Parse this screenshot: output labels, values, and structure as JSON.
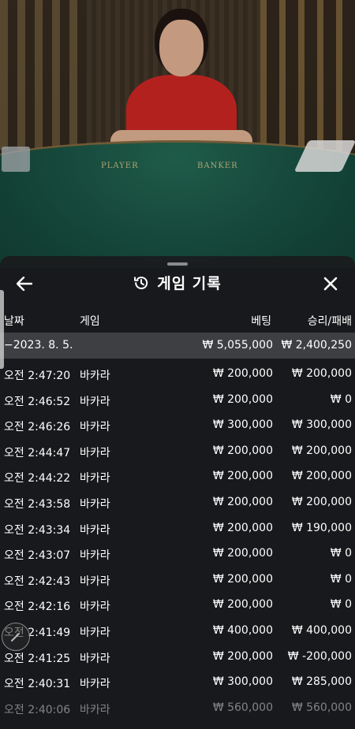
{
  "header": {
    "title": "게임 기록"
  },
  "columns": {
    "date": "날짜",
    "game": "게임",
    "bet": "베팅",
    "result": "승리/패배"
  },
  "summary": {
    "date": "−2023. 8. 5.",
    "bet": "₩ 5,055,000",
    "result": "₩ 2,400,250"
  },
  "rows": [
    {
      "time": "오전 2:47:20",
      "game": "바카라",
      "bet": "₩ 200,000",
      "result": "₩ 200,000"
    },
    {
      "time": "오전 2:46:52",
      "game": "바카라",
      "bet": "₩ 200,000",
      "result": "₩ 0"
    },
    {
      "time": "오전 2:46:26",
      "game": "바카라",
      "bet": "₩ 300,000",
      "result": "₩ 300,000"
    },
    {
      "time": "오전 2:44:47",
      "game": "바카라",
      "bet": "₩ 200,000",
      "result": "₩ 200,000"
    },
    {
      "time": "오전 2:44:22",
      "game": "바카라",
      "bet": "₩ 200,000",
      "result": "₩ 200,000"
    },
    {
      "time": "오전 2:43:58",
      "game": "바카라",
      "bet": "₩ 200,000",
      "result": "₩ 200,000"
    },
    {
      "time": "오전 2:43:34",
      "game": "바카라",
      "bet": "₩ 200,000",
      "result": "₩ 190,000"
    },
    {
      "time": "오전 2:43:07",
      "game": "바카라",
      "bet": "₩ 200,000",
      "result": "₩ 0"
    },
    {
      "time": "오전 2:42:43",
      "game": "바카라",
      "bet": "₩ 200,000",
      "result": "₩ 0"
    },
    {
      "time": "오전 2:42:16",
      "game": "바카라",
      "bet": "₩ 200,000",
      "result": "₩ 0"
    },
    {
      "time": "오전 2:41:49",
      "game": "바카라",
      "bet": "₩ 400,000",
      "result": "₩ 400,000"
    },
    {
      "time": "오전 2:41:25",
      "game": "바카라",
      "bet": "₩ 200,000",
      "result": "₩ -200,000"
    },
    {
      "time": "오전 2:40:31",
      "game": "바카라",
      "bet": "₩ 300,000",
      "result": "₩ 285,000"
    },
    {
      "time": "오전 2:40:06",
      "game": "바카라",
      "bet": "₩ 560,000",
      "result": "₩ 560,000"
    }
  ],
  "background": {
    "table_label_player": "PLAYER",
    "table_label_banker": "BANKER"
  },
  "colors": {
    "sheet_bg": "#1a1b1d",
    "summary_bg": "#3d3f42",
    "table_felt": "#134236",
    "dealer_dress": "#b3211f"
  },
  "icons": {
    "back": "arrow-left-icon",
    "history": "history-icon",
    "close": "close-icon"
  }
}
